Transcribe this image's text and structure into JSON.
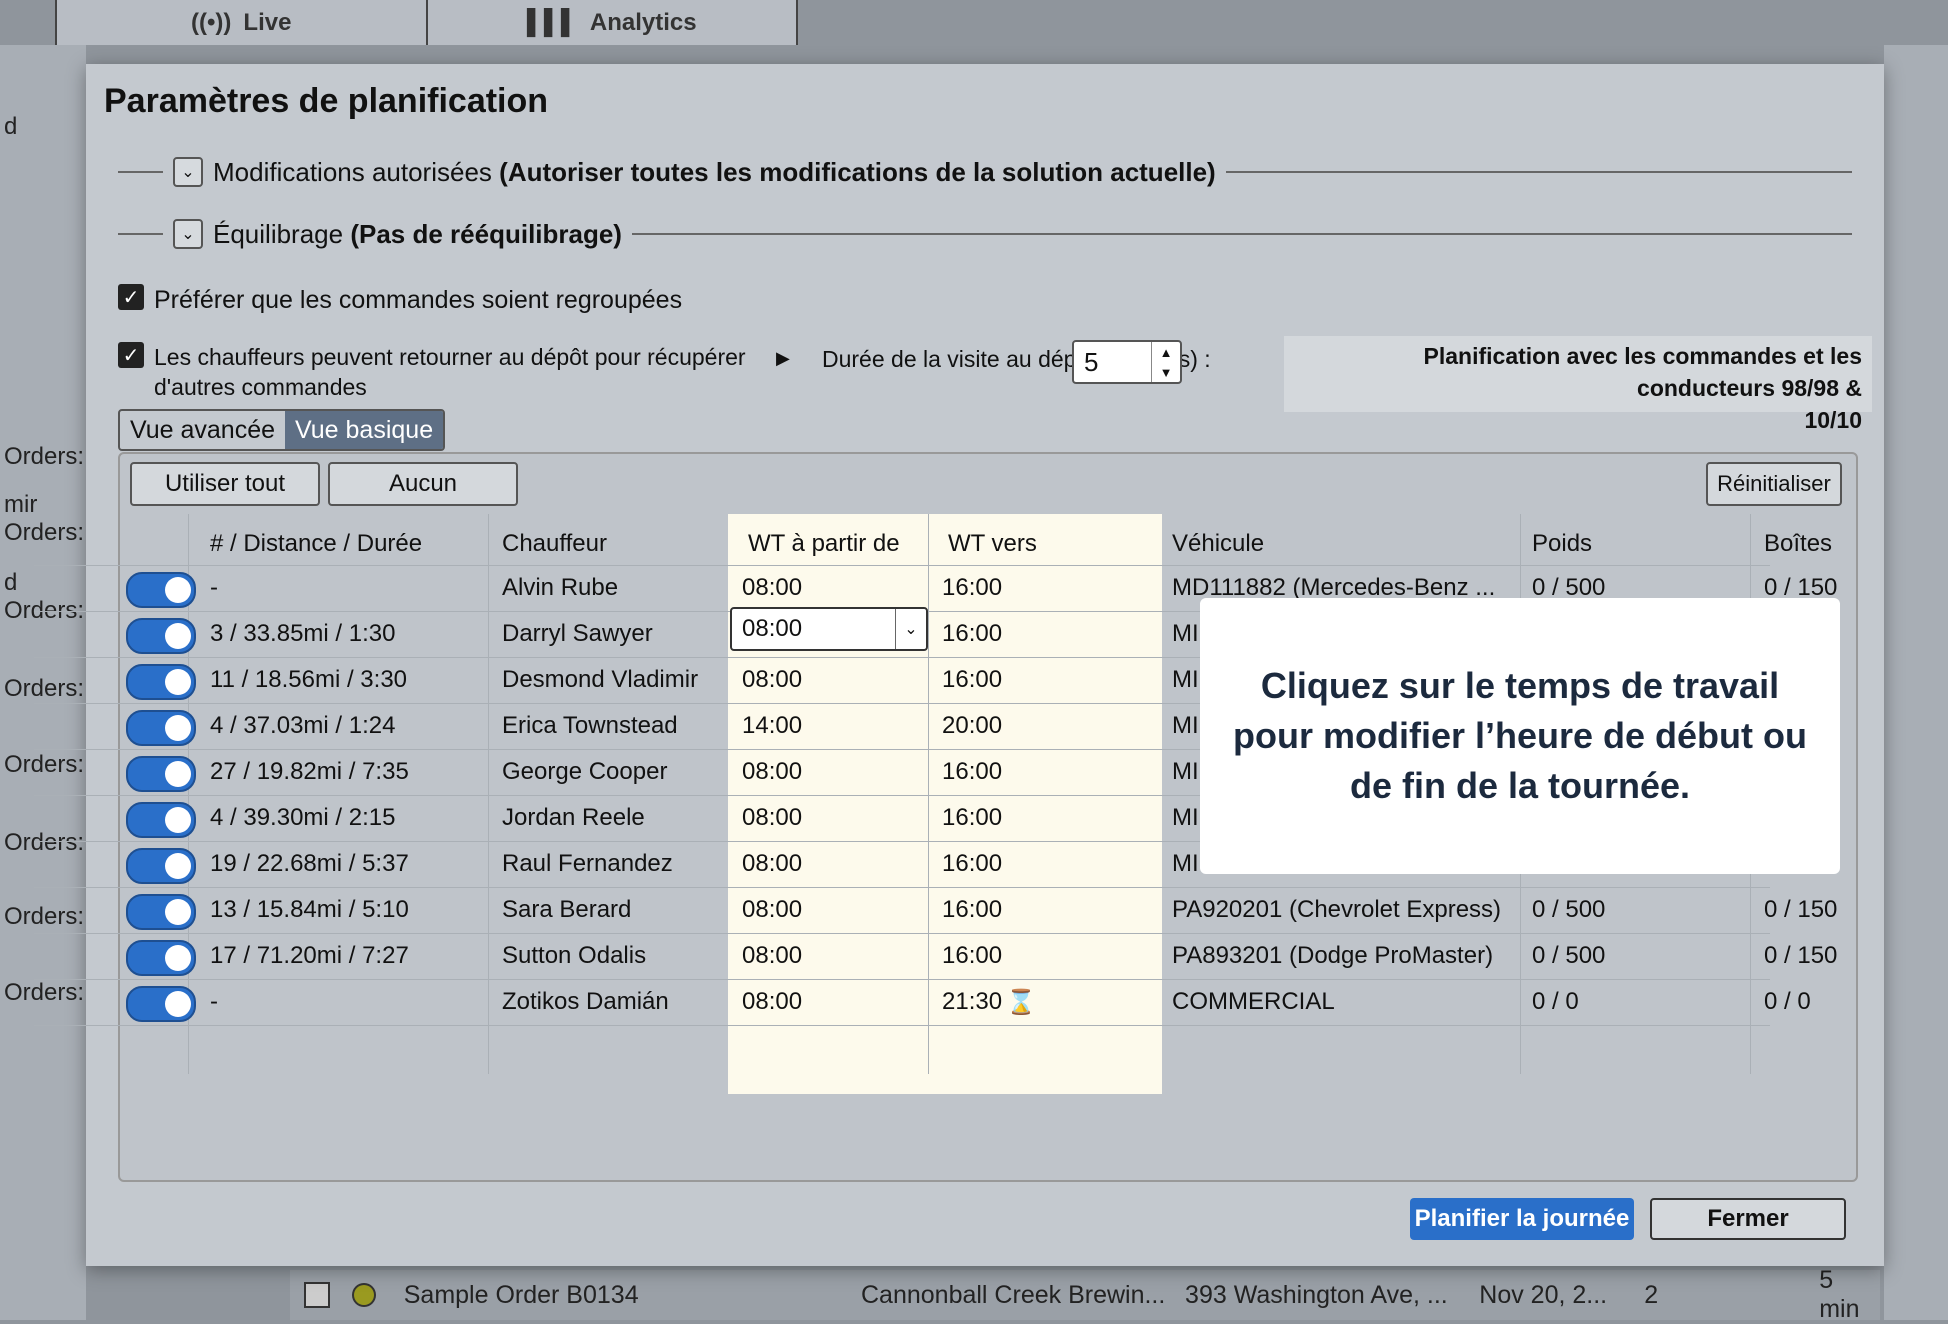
{
  "app_tabs": [
    {
      "label": "Live",
      "icon": "broadcast-icon"
    },
    {
      "label": "Analytics",
      "icon": "bar-chart-icon"
    }
  ],
  "background": {
    "left_labels": [
      "d",
      "Orders:",
      "mir",
      "Orders:",
      "d",
      "Orders:",
      "Orders:",
      "Orders:",
      "Orders:",
      "Orders:",
      "Orders:"
    ],
    "bottom_row": {
      "name": "Sample Order B0134",
      "customer": "Cannonball Creek Brewin...",
      "address": "393 Washington Ave, ...",
      "date": "Nov 20, 2...",
      "count": "2",
      "duration": "5 min"
    }
  },
  "modal": {
    "title": "Paramètres de planification",
    "sections": [
      {
        "label": "Modifications autorisées",
        "detail": "(Autoriser toutes les modifications de la solution actuelle)"
      },
      {
        "label": "Équilibrage",
        "detail": "(Pas de rééquilibrage)"
      }
    ],
    "options": {
      "group_orders": "Préférer que les commandes soient regroupées",
      "return_depot_1": "Les chauffeurs peuvent retourner au dépôt pour récupérer",
      "return_depot_2": "d'autres commandes",
      "depot_visit_label": "Durée de la visite au dépôt (minutes) :",
      "depot_visit_value": "5"
    },
    "planning_info_1": "Planification avec les commandes et les conducteurs 98/98 &",
    "planning_info_2": "10/10",
    "views": {
      "advanced": "Vue avancée",
      "basic": "Vue basique"
    },
    "buttons": {
      "use_all": "Utiliser tout",
      "none": "Aucun",
      "reset": "Réinitialiser",
      "plan": "Planifier la journée",
      "close": "Fermer"
    },
    "columns": [
      "# / Distance / Durée",
      "Chauffeur",
      "WT à partir de",
      "WT vers",
      "Véhicule",
      "Poids",
      "Boîtes"
    ],
    "rows": [
      {
        "stats": "-",
        "driver": "Alvin Rube",
        "from": "08:00",
        "to": "16:00",
        "vehicle": "MD111882 (Mercedes-Benz ...",
        "weight": "0 / 500",
        "boxes": "0 / 150"
      },
      {
        "stats": "3 / 33.85mi / 1:30",
        "driver": "Darryl Sawyer",
        "from": "08:00",
        "to": "16:00",
        "vehicle": "MI",
        "weight": "",
        "boxes": ""
      },
      {
        "stats": "11 / 18.56mi / 3:30",
        "driver": "Desmond Vladimir",
        "from": "08:00",
        "to": "16:00",
        "vehicle": "MI",
        "weight": "",
        "boxes": ""
      },
      {
        "stats": "4 / 37.03mi / 1:24",
        "driver": "Erica Townstead",
        "from": "14:00",
        "to": "20:00",
        "vehicle": "MI",
        "weight": "",
        "boxes": ""
      },
      {
        "stats": "27 / 19.82mi / 7:35",
        "driver": "George Cooper",
        "from": "08:00",
        "to": "16:00",
        "vehicle": "MI",
        "weight": "",
        "boxes": ""
      },
      {
        "stats": "4 / 39.30mi / 2:15",
        "driver": "Jordan Reele",
        "from": "08:00",
        "to": "16:00",
        "vehicle": "MI",
        "weight": "",
        "boxes": ""
      },
      {
        "stats": "19 / 22.68mi / 5:37",
        "driver": "Raul Fernandez",
        "from": "08:00",
        "to": "16:00",
        "vehicle": "MI",
        "weight": "",
        "boxes": ""
      },
      {
        "stats": "13 / 15.84mi / 5:10",
        "driver": "Sara Berard",
        "from": "08:00",
        "to": "16:00",
        "vehicle": "PA920201 (Chevrolet Express)",
        "weight": "0 / 500",
        "boxes": "0 / 150"
      },
      {
        "stats": "17 / 71.20mi / 7:27",
        "driver": "Sutton Odalis",
        "from": "08:00",
        "to": "16:00",
        "vehicle": "PA893201 (Dodge ProMaster)",
        "weight": "0 / 500",
        "boxes": "0 / 150"
      },
      {
        "stats": "-",
        "driver": "Zotikos Damián",
        "from": "08:00",
        "to": "21:30",
        "vehicle": "COMMERCIAL",
        "weight": "0 / 0",
        "boxes": "0 / 0"
      }
    ],
    "tooltip": "Cliquez sur le temps de travail pour modifier l’heure de début ou de fin de la tournée."
  }
}
